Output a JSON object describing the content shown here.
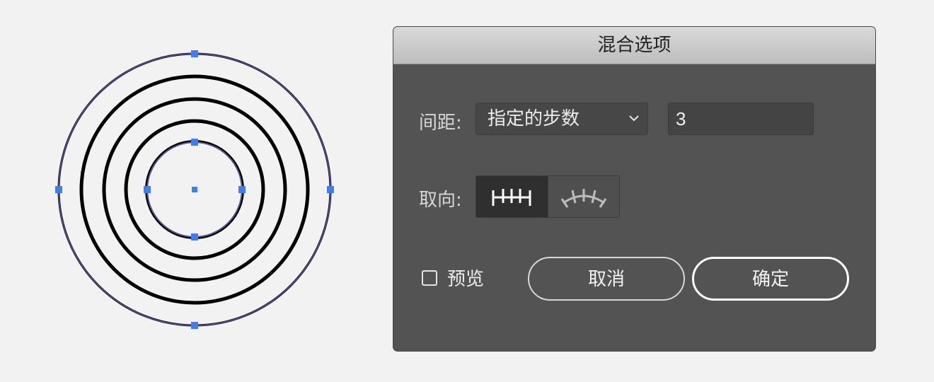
{
  "dialog": {
    "title": "混合选项",
    "spacing": {
      "label": "间距:",
      "selected_option": "指定的步数",
      "steps_value": "3"
    },
    "orientation": {
      "label": "取向:",
      "options": [
        "align-to-page-icon",
        "align-to-path-icon"
      ],
      "selected": "align-to-page-icon"
    },
    "preview": {
      "label": "预览",
      "checked": false
    },
    "buttons": {
      "cancel": "取消",
      "ok": "确定"
    }
  },
  "canvas": {
    "accent_color": "#3d7ef0",
    "path_color": "#5a5aa6",
    "stroke_color": "#000000"
  }
}
